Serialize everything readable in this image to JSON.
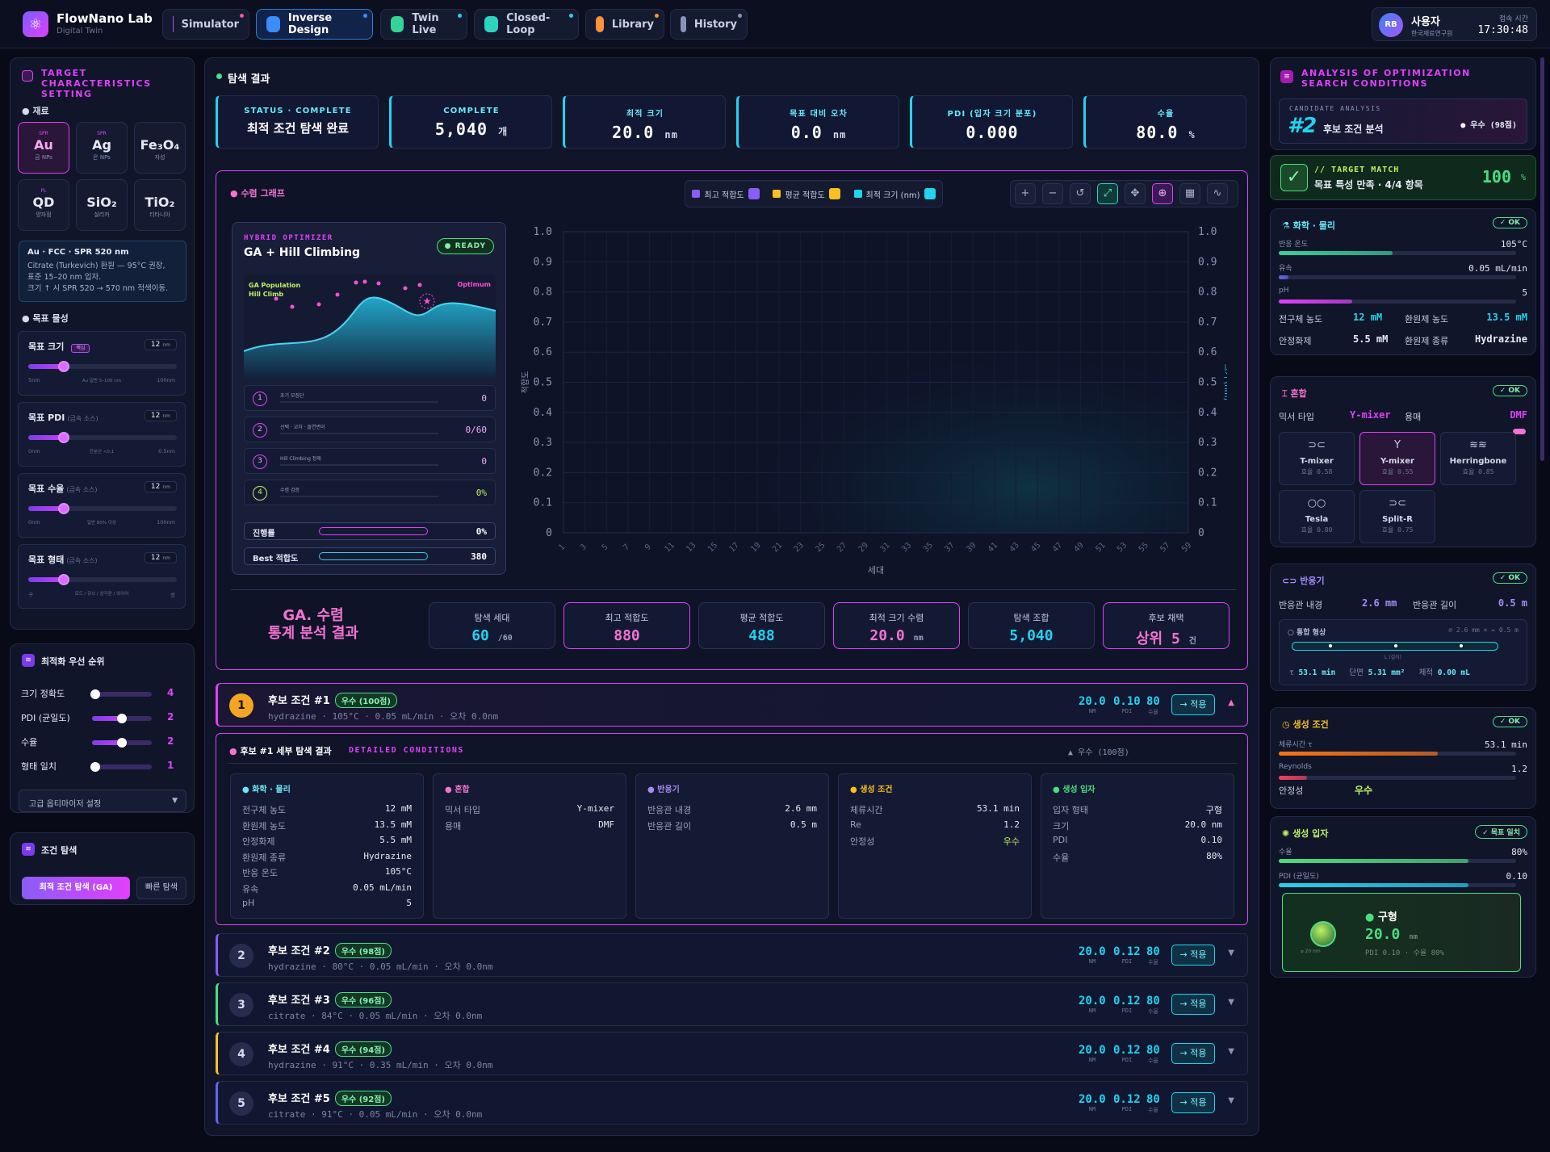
{
  "app": {
    "title": "FlowNano Lab",
    "subtitle": "Digital Twin"
  },
  "nav": [
    {
      "label": "Simulator",
      "active": false,
      "color": "#c04cf0",
      "dot": "#ff4fa0"
    },
    {
      "label": "Inverse Design",
      "active": true,
      "color": "#3b8cff",
      "dot": "#3b8cff"
    },
    {
      "label": "Twin Live",
      "active": false,
      "color": "#34d399",
      "dot": "#22d3ee"
    },
    {
      "label": "Closed-Loop",
      "active": false,
      "color": "#2dd4bf",
      "dot": "#22d3ee"
    },
    {
      "label": "Library",
      "active": false,
      "color": "#fb923c",
      "dot": "#fb923c"
    },
    {
      "label": "History",
      "active": false,
      "color": "#8b93b5",
      "dot": "#8b93b5"
    }
  ],
  "user": {
    "initials": "RB",
    "name": "사용자",
    "org": "한국재료연구원",
    "time_label": "접속 시간",
    "time": "17:30:48"
  },
  "left": {
    "target_title": "TARGET CHARACTERISTICS SETTING",
    "material_label": "재료",
    "materials": [
      {
        "tag": "SPR",
        "symbol": "Au",
        "name": "금 NPs",
        "selected": true
      },
      {
        "tag": "SPR",
        "symbol": "Ag",
        "name": "은 NPs",
        "selected": false
      },
      {
        "tag": "",
        "symbol": "Fe₃O₄",
        "name": "자성",
        "selected": false
      },
      {
        "tag": "PL",
        "symbol": "QD",
        "name": "양자점",
        "selected": false
      },
      {
        "tag": "",
        "symbol": "SiO₂",
        "name": "실리카",
        "selected": false
      },
      {
        "tag": "",
        "symbol": "TiO₂",
        "name": "티타니아",
        "selected": false
      }
    ],
    "info_title": "Au · FCC · SPR 520 nm",
    "info_lines": [
      "Citrate (Turkevich) 환원 — 95°C 권장,",
      "표준 15–20 nm 입자.",
      "크기 ↑ 시 SPR 520 → 570 nm 적색이동."
    ],
    "props_label": "목표 물성",
    "props": [
      {
        "label": "목표 크기",
        "sub": "",
        "tag": "핵심",
        "value": "12",
        "unit": "nm",
        "min": "5nm",
        "mid": "Au 일반 5–100 nm",
        "max": "100nm",
        "fraction": 0.24
      },
      {
        "label": "목표 PDI",
        "sub": "(금속 소스)",
        "tag": "",
        "value": "12",
        "unit": "nm",
        "min": "0nm",
        "mid": "단분산 <0.1",
        "max": "0.5nm",
        "fraction": 0.24
      },
      {
        "label": "목표 수율",
        "sub": "(금속 소스)",
        "tag": "",
        "value": "12",
        "unit": "nm",
        "min": "0nm",
        "mid": "일반 80% 이상",
        "max": "100nm",
        "fraction": 0.24
      },
      {
        "label": "목표 형태",
        "sub": "(금속 소스)",
        "tag": "",
        "value": "12",
        "unit": "nm",
        "min": "구",
        "mid": "로드 / 큐브 / 삼각판 / 와이어",
        "max": "성",
        "fraction": 0.24
      }
    ],
    "priority_title": "최적화 우선 순위",
    "priorities": [
      {
        "label": "크기 정확도",
        "value": "4",
        "fraction": 0.05
      },
      {
        "label": "PDI (균일도)",
        "value": "2",
        "fraction": 0.5
      },
      {
        "label": "수율",
        "value": "2",
        "fraction": 0.5
      },
      {
        "label": "형태 일치",
        "value": "1",
        "fraction": 0.05
      }
    ],
    "advanced_label": "고급 옵티마이저 설정",
    "search_title": "조건 탐색",
    "search_primary": "최적 조건 탐색 (GA)",
    "search_quick": "빠른 탐색"
  },
  "main": {
    "header": "탐색 결과",
    "stats": [
      {
        "label": "STATUS · COMPLETE",
        "value": "최적 조건 탐색 완료",
        "unit": ""
      },
      {
        "label": "COMPLETE",
        "value": "5,040",
        "unit": "개"
      },
      {
        "label": "최적 크기",
        "value": "20.0",
        "unit": "nm"
      },
      {
        "label": "목표 대비 오차",
        "value": "0.0",
        "unit": "nm"
      },
      {
        "label": "PDI (입자 크기 분포)",
        "value": "0.000",
        "unit": ""
      },
      {
        "label": "수율",
        "value": "80.0",
        "unit": "%"
      }
    ],
    "graph_title": "수렴 그래프",
    "legend": [
      {
        "label": "최고 적합도",
        "color": "#8b5cf6"
      },
      {
        "label": "평균 적합도",
        "color": "#fbbf24"
      },
      {
        "label": "최적 크기 (nm)",
        "color": "#22d3ee"
      }
    ],
    "tools": [
      "+",
      "−",
      "↺",
      "⤢",
      "✥",
      "⊕",
      "▦",
      "∿"
    ],
    "optimizer": {
      "tag": "HYBRID OPTIMIZER",
      "status": "READY",
      "name": "GA + Hill Climbing",
      "chart_label_1": "GA Population",
      "chart_label_2": "Hill Climb",
      "chart_label_3": "Optimum",
      "steps": [
        {
          "n": "1",
          "label": "초기 모집단",
          "value": "0"
        },
        {
          "n": "2",
          "label": "선택 · 교차 · 돌연변이",
          "value": "0/60"
        },
        {
          "n": "3",
          "label": "Hill Climbing 정제",
          "value": "0"
        },
        {
          "n": "4",
          "label": "수렴 검증",
          "value": "0%"
        }
      ],
      "progress_label": "진행률",
      "progress_value": "0%",
      "best_label": "Best 적합도",
      "best_value": "380"
    },
    "bottom_label_1": "GA. 수렴",
    "bottom_label_2": "통계 분석 결과",
    "bottom_stats": [
      {
        "label": "탐색 세대",
        "value": "60",
        "unit": "/60",
        "pink": false
      },
      {
        "label": "최고 적합도",
        "value": "880",
        "unit": "",
        "pink": true
      },
      {
        "label": "평균 적합도",
        "value": "488",
        "unit": "",
        "pink": false
      },
      {
        "label": "최적 크기 수렴",
        "value": "20.0",
        "unit": "nm",
        "pink": true
      },
      {
        "label": "탐색 조합",
        "value": "5,040",
        "unit": "",
        "pink": false
      },
      {
        "label": "후보 채택",
        "value": "상위 5",
        "unit": "건",
        "pink": true
      }
    ],
    "candidates": [
      {
        "n": "1",
        "title": "후보 조건 #1",
        "badge": "우수 (100점)",
        "sub": "hydrazine · 105°C · 0.05 mL/min · 오차 0.0nm",
        "size": "20.0",
        "pdi": "0.10",
        "yield": "80",
        "accent": "#e040fb"
      },
      {
        "n": "2",
        "title": "후보 조건 #2",
        "badge": "우수 (98점)",
        "sub": "hydrazine · 80°C · 0.05 mL/min · 오차 0.0nm",
        "size": "20.0",
        "pdi": "0.12",
        "yield": "80",
        "accent": "#8b5cf6"
      },
      {
        "n": "3",
        "title": "후보 조건 #3",
        "badge": "우수 (96점)",
        "sub": "citrate · 84°C · 0.05 mL/min · 오차 0.0nm",
        "size": "20.0",
        "pdi": "0.12",
        "yield": "80",
        "accent": "#4ade80"
      },
      {
        "n": "4",
        "title": "후보 조건 #4",
        "badge": "우수 (94점)",
        "sub": "hydrazine · 91°C · 0.35 mL/min · 오차 0.0nm",
        "size": "20.0",
        "pdi": "0.12",
        "yield": "80",
        "accent": "#fbbf24"
      },
      {
        "n": "5",
        "title": "후보 조건 #5",
        "badge": "우수 (92점)",
        "sub": "citrate · 91°C · 0.05 mL/min · 오차 0.0nm",
        "size": "20.0",
        "pdi": "0.12",
        "yield": "80",
        "accent": "#6366f1"
      }
    ],
    "metric_labels": {
      "size": "NM",
      "pdi": "PDI",
      "yield": "수율"
    },
    "apply_label": "→ 적용",
    "detail": {
      "title": "후보 #1 세부 탐색 결과",
      "sub": "DETAILED CONDITIONS",
      "score": "▲ 우수 (100점)",
      "cards": [
        {
          "h": "화학 · 물리",
          "color": "#6ee7f7",
          "rows": [
            [
              "전구체 농도",
              "12 mM"
            ],
            [
              "환원제 농도",
              "13.5 mM"
            ],
            [
              "안정화제",
              "5.5 mM"
            ],
            [
              "환원제 종류",
              "Hydrazine"
            ],
            [
              "반응 온도",
              "105°C"
            ],
            [
              "유속",
              "0.05 mL/min"
            ],
            [
              "pH",
              "5"
            ]
          ]
        },
        {
          "h": "혼합",
          "color": "#f472d0",
          "rows": [
            [
              "믹서 타입",
              "Y-mixer"
            ],
            [
              "용매",
              "DMF"
            ]
          ]
        },
        {
          "h": "반응기",
          "color": "#a78bfa",
          "rows": [
            [
              "반응관 내경",
              "2.6 mm"
            ],
            [
              "반응관 길이",
              "0.5 m"
            ]
          ]
        },
        {
          "h": "생성 조건",
          "color": "#fbbf24",
          "rows": [
            [
              "체류시간",
              "53.1 min"
            ],
            [
              "Re",
              "1.2"
            ],
            [
              "안정성",
              "우수"
            ]
          ]
        },
        {
          "h": "생성 입자",
          "color": "#4ade80",
          "rows": [
            [
              "입자 형태",
              "구형"
            ],
            [
              "크기",
              "20.0 nm"
            ],
            [
              "PDI",
              "0.10"
            ],
            [
              "수율",
              "80%"
            ]
          ]
        }
      ]
    }
  },
  "chart_data": {
    "type": "line",
    "xlabel": "세대",
    "ylabel": "적합도",
    "y2label": "크기 (nm)",
    "x": [
      "1",
      "3",
      "5",
      "7",
      "9",
      "11",
      "13",
      "15",
      "17",
      "19",
      "21",
      "23",
      "25",
      "27",
      "29",
      "31",
      "33",
      "35",
      "37",
      "39",
      "41",
      "43",
      "45",
      "47",
      "49",
      "51",
      "53",
      "55",
      "57",
      "59"
    ],
    "yticks": [
      "1.0",
      "0.9",
      "0.8",
      "0.7",
      "0.6",
      "0.5",
      "0.4",
      "0.3",
      "0.2",
      "0.1",
      "0"
    ],
    "ylim": [
      0,
      1.0
    ],
    "series": []
  },
  "right": {
    "title": "ANALYSIS OF OPTIMIZATION SEARCH CONDITIONS",
    "cand_label": "CANDIDATE ANALYSIS",
    "cand_num": "#2",
    "cand_text": "후보 조건 분석",
    "cand_score": "우수 (98점)",
    "match_tag": "// TARGET MATCH",
    "match_text": "목표 특성 만족 · 4/4 항목",
    "match_value": "100",
    "match_unit": "%",
    "ok": "✓ OK",
    "chem": {
      "title": "화학 · 물리",
      "bars": [
        {
          "label": "반응 온도",
          "value": "105°C",
          "fraction": 0.48,
          "color": "#34d399"
        },
        {
          "label": "유속",
          "value": "0.05 mL/min",
          "fraction": 0.04,
          "color": "#6366f1"
        },
        {
          "label": "pH",
          "value": "5",
          "fraction": 0.31,
          "color": "#e040fb"
        }
      ],
      "kv": [
        [
          "전구체 농도",
          "12 mM"
        ],
        [
          "환원제 농도",
          "13.5 mM"
        ],
        [
          "안정화제",
          "5.5 mM"
        ],
        [
          "환원제 종류",
          "Hydrazine"
        ]
      ]
    },
    "mix": {
      "title": "혼합",
      "type_label": "믹서 타입",
      "type_value": "Y-mixer",
      "solvent_label": "용매",
      "solvent_value": "DMF",
      "mixers": [
        {
          "name": "T-mixer",
          "eff": "효율 0.58",
          "selected": false
        },
        {
          "name": "Y-mixer",
          "eff": "효율 0.55",
          "selected": true
        },
        {
          "name": "Herringbone",
          "eff": "효율 0.85",
          "selected": false
        },
        {
          "name": "Tesla",
          "eff": "효율 0.80",
          "selected": false
        },
        {
          "name": "Split-R",
          "eff": "효율 0.75",
          "selected": false
        }
      ]
    },
    "reactor": {
      "title": "반응기",
      "d_label": "반응관 내경",
      "d_value": "2.6 mm",
      "l_label": "반응관 길이",
      "l_value": "0.5 m",
      "shape_label": "○ 통합 형상",
      "shape_dims": "⌀ 2.6 mm × ⇔ 0.5 m",
      "l_axis": "L (길이)",
      "tau_label": "τ",
      "tau_value": "53.1 min",
      "area_label": "단면",
      "area_value": "5.31 mm²",
      "vol_label": "체적",
      "vol_value": "0.00 mL"
    },
    "gen": {
      "title": "생성 조건",
      "bars": [
        {
          "label": "체류시간 τ",
          "value": "53.1 min",
          "fraction": 0.67,
          "color": "#f97316"
        },
        {
          "label": "Reynolds",
          "value": "1.2",
          "fraction": 0.12,
          "color": "#f43f5e"
        }
      ],
      "stab_label": "안정성",
      "stab_value": "우수"
    },
    "particle": {
      "title": "생성 입자",
      "badge": "✓ 목표 일치",
      "bars": [
        {
          "label": "수율",
          "value": "80%",
          "fraction": 0.8,
          "color": "#4ade80"
        },
        {
          "label": "PDI (균일도)",
          "value": "0.10",
          "fraction": 0.8,
          "color": "#22d3ee"
        }
      ],
      "shape": "구형",
      "size": "20.0",
      "size_unit": "nm",
      "sub": "PDI 0.10 · 수율 80%",
      "icon_caption": "⌀ 20 nm"
    }
  }
}
